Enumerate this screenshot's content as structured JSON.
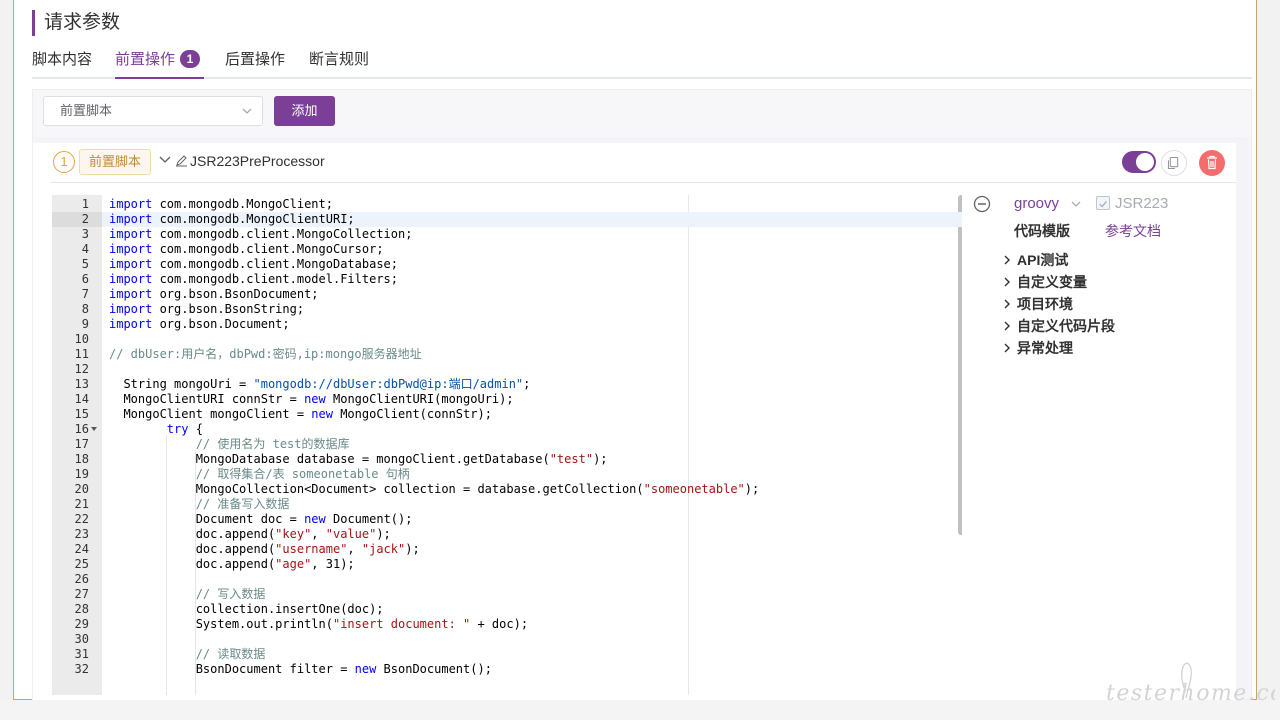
{
  "section": {
    "title": "请求参数"
  },
  "tabs": [
    {
      "label": "脚本内容",
      "active": false
    },
    {
      "label": "前置操作",
      "active": true,
      "badge": "1"
    },
    {
      "label": "后置操作",
      "active": false
    },
    {
      "label": "断言规则",
      "active": false
    }
  ],
  "toolbar": {
    "select_value": "前置脚本",
    "add_label": "添加"
  },
  "step": {
    "number": "1",
    "tag": "前置脚本",
    "name": "JSR223PreProcessor",
    "enabled": true
  },
  "side_panel": {
    "language": "groovy",
    "engine_label": "JSR223",
    "engine_checked": true,
    "template_label": "代码模版",
    "docs_label": "参考文档",
    "tree": [
      "API测试",
      "自定义变量",
      "项目环境",
      "自定义代码片段",
      "异常处理"
    ]
  },
  "editor": {
    "current_line": 2,
    "lines": [
      {
        "n": "1",
        "text": "import com.mongodb.MongoClient;"
      },
      {
        "n": "2",
        "text": "import com.mongodb.MongoClientURI;"
      },
      {
        "n": "3",
        "text": "import com.mongodb.client.MongoCollection;"
      },
      {
        "n": "4",
        "text": "import com.mongodb.client.MongoCursor;"
      },
      {
        "n": "5",
        "text": "import com.mongodb.client.MongoDatabase;"
      },
      {
        "n": "6",
        "text": "import com.mongodb.client.model.Filters;"
      },
      {
        "n": "7",
        "text": "import org.bson.BsonDocument;"
      },
      {
        "n": "8",
        "text": "import org.bson.BsonString;"
      },
      {
        "n": "9",
        "text": "import org.bson.Document;"
      },
      {
        "n": "10",
        "text": ""
      },
      {
        "n": "11",
        "text": "// dbUser:用户名，dbPwd:密码,ip:mongo服务器地址"
      },
      {
        "n": "12",
        "text": ""
      },
      {
        "n": "13",
        "text": "  String mongoUri = \"mongodb://dbUser:dbPwd@ip:端口/admin\";"
      },
      {
        "n": "14",
        "text": "  MongoClientURI connStr = new MongoClientURI(mongoUri);"
      },
      {
        "n": "15",
        "text": "  MongoClient mongoClient = new MongoClient(connStr);"
      },
      {
        "n": "16",
        "text": "        try {"
      },
      {
        "n": "17",
        "text": "            // 使用名为 test的数据库"
      },
      {
        "n": "18",
        "text": "            MongoDatabase database = mongoClient.getDatabase(\"test\");"
      },
      {
        "n": "19",
        "text": "            // 取得集合/表 someonetable 句柄"
      },
      {
        "n": "20",
        "text": "            MongoCollection<Document> collection = database.getCollection(\"someonetable\");"
      },
      {
        "n": "21",
        "text": "            // 准备写入数据"
      },
      {
        "n": "22",
        "text": "            Document doc = new Document();"
      },
      {
        "n": "23",
        "text": "            doc.append(\"key\", \"value\");"
      },
      {
        "n": "24",
        "text": "            doc.append(\"username\", \"jack\");"
      },
      {
        "n": "25",
        "text": "            doc.append(\"age\", 31);"
      },
      {
        "n": "26",
        "text": ""
      },
      {
        "n": "27",
        "text": "            // 写入数据"
      },
      {
        "n": "28",
        "text": "            collection.insertOne(doc);"
      },
      {
        "n": "29",
        "text": "            System.out.println(\"insert document: \" + doc);"
      },
      {
        "n": "30",
        "text": ""
      },
      {
        "n": "31",
        "text": "            // 读取数据"
      },
      {
        "n": "32",
        "text": "            BsonDocument filter = new BsonDocument();"
      }
    ]
  },
  "watermark": "testerhome.com",
  "colors": {
    "accent": "#7b3f98",
    "warning": "#e6a23c",
    "danger": "#f56c6c"
  }
}
